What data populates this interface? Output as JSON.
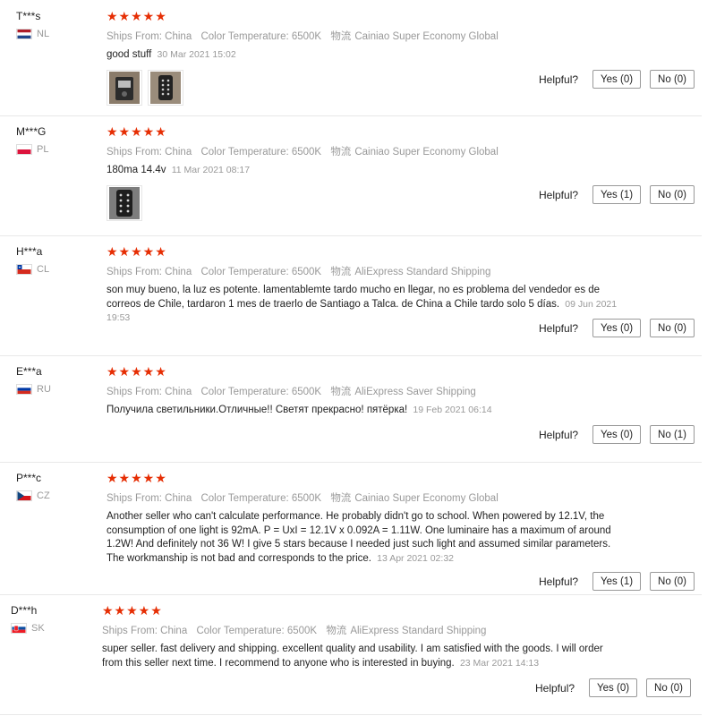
{
  "reviews": [
    {
      "user": "T***s",
      "country": "NL",
      "flag": "nl",
      "stars": "★★★★★",
      "ships_from": "Ships From: China",
      "color_temp": "Color Temperature: 6500K",
      "logistics_label": "物流",
      "logistics": "Cainiao Super Economy Global",
      "text": "good stuff",
      "date": "30 Mar 2021 15:02",
      "photos": 2,
      "helpful_label": "Helpful?",
      "yes": "Yes (0)",
      "no": "No (0)"
    },
    {
      "user": "M***G",
      "country": "PL",
      "flag": "pl",
      "stars": "★★★★★",
      "ships_from": "Ships From: China",
      "color_temp": "Color Temperature: 6500K",
      "logistics_label": "物流",
      "logistics": "Cainiao Super Economy Global",
      "text": "180ma 14.4v",
      "date": "11 Mar 2021 08:17",
      "photos": 1,
      "helpful_label": "Helpful?",
      "yes": "Yes (1)",
      "no": "No (0)"
    },
    {
      "user": "H***a",
      "country": "CL",
      "flag": "cl",
      "stars": "★★★★★",
      "ships_from": "Ships From: China",
      "color_temp": "Color Temperature: 6500K",
      "logistics_label": "物流",
      "logistics": "AliExpress Standard Shipping",
      "text": "son muy bueno, la luz es potente. lamentablemte tardo mucho en llegar, no es problema del vendedor es de correos de Chile, tardaron 1 mes de traerlo de Santiago a Talca. de China a Chile tardo solo 5 días.",
      "date": "09 Jun 2021 19:53",
      "photos": 0,
      "helpful_label": "Helpful?",
      "yes": "Yes (0)",
      "no": "No (0)"
    },
    {
      "user": "E***a",
      "country": "RU",
      "flag": "ru",
      "stars": "★★★★★",
      "ships_from": "Ships From: China",
      "color_temp": "Color Temperature: 6500K",
      "logistics_label": "物流",
      "logistics": "AliExpress Saver Shipping",
      "text": "Получила светильники.Отличные!! Светят прекрасно! пятёрка!",
      "date": "19 Feb 2021 06:14",
      "photos": 0,
      "helpful_label": "Helpful?",
      "yes": "Yes (0)",
      "no": "No (1)"
    },
    {
      "user": "P***c",
      "country": "CZ",
      "flag": "cz",
      "stars": "★★★★★",
      "ships_from": "Ships From: China",
      "color_temp": "Color Temperature: 6500K",
      "logistics_label": "物流",
      "logistics": "Cainiao Super Economy Global",
      "text": "Another seller who can't calculate performance. He probably didn't go to school. When powered by 12.1V, the consumption of one light is 92mA. P = UxI = 12.1V x 0.092A = 1.11W. One luminaire has a maximum of around 1.2W! And definitely not 36 W! I give 5 stars because I needed just such light and assumed similar parameters. The workmanship is not bad and corresponds to the price.",
      "date": "13 Apr 2021 02:32",
      "photos": 0,
      "helpful_label": "Helpful?",
      "yes": "Yes (1)",
      "no": "No (0)"
    },
    {
      "user": "D***h",
      "country": "SK",
      "flag": "sk",
      "stars": "★★★★★",
      "ships_from": "Ships From: China",
      "color_temp": "Color Temperature: 6500K",
      "logistics_label": "物流",
      "logistics": "AliExpress Standard Shipping",
      "text": "super seller. fast delivery and shipping. excellent quality and usability. I am satisfied with the goods. I will order from this seller next time. I recommend to anyone who is interested in buying.",
      "date": "23 Mar 2021 14:13",
      "photos": 0,
      "helpful_label": "Helpful?",
      "yes": "Yes (0)",
      "no": "No (0)"
    }
  ]
}
